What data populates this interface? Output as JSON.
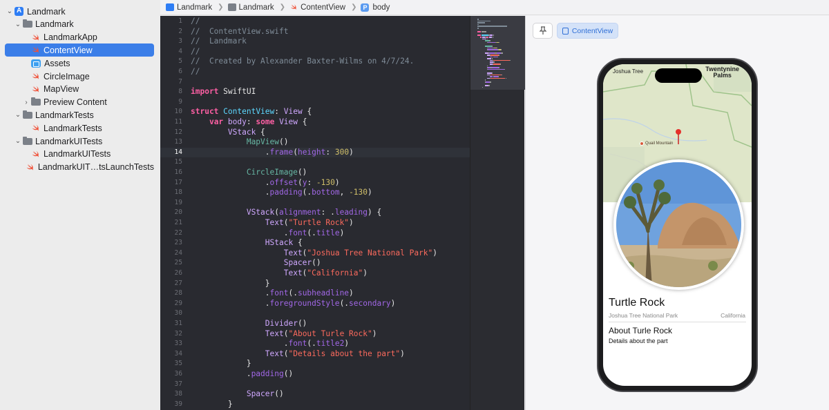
{
  "navigator": {
    "items": [
      {
        "label": "Landmark",
        "level": 0,
        "icon": "app-icon",
        "expanded": true
      },
      {
        "label": "Landmark",
        "level": 1,
        "icon": "folder-icon",
        "expanded": true
      },
      {
        "label": "LandmarkApp",
        "level": 2,
        "icon": "swift-file-icon"
      },
      {
        "label": "ContentView",
        "level": 2,
        "icon": "swift-file-icon",
        "selected": true
      },
      {
        "label": "Assets",
        "level": 2,
        "icon": "assets-icon"
      },
      {
        "label": "CircleImage",
        "level": 2,
        "icon": "swift-file-icon"
      },
      {
        "label": "MapView",
        "level": 2,
        "icon": "swift-file-icon"
      },
      {
        "label": "Preview Content",
        "level": 2,
        "icon": "folder-icon",
        "expanded": false
      },
      {
        "label": "LandmarkTests",
        "level": 1,
        "icon": "folder-icon",
        "expanded": true
      },
      {
        "label": "LandmarkTests",
        "level": 2,
        "icon": "swift-file-icon"
      },
      {
        "label": "LandmarkUITests",
        "level": 1,
        "icon": "folder-icon",
        "expanded": true
      },
      {
        "label": "LandmarkUITests",
        "level": 2,
        "icon": "swift-file-icon"
      },
      {
        "label": "LandmarkUIT…tsLaunchTests",
        "level": 2,
        "icon": "swift-file-icon"
      }
    ]
  },
  "breadcrumb": {
    "items": [
      "Landmark",
      "Landmark",
      "ContentView",
      "body"
    ]
  },
  "editor": {
    "current_line": 14,
    "lines": [
      [
        [
          "c-com",
          "//"
        ]
      ],
      [
        [
          "c-com",
          "//  ContentView.swift"
        ]
      ],
      [
        [
          "c-com",
          "//  Landmark"
        ]
      ],
      [
        [
          "c-com",
          "//"
        ]
      ],
      [
        [
          "c-com",
          "//  Created by Alexander Baxter-Wilms on 4/7/24."
        ]
      ],
      [
        [
          "c-com",
          "//"
        ]
      ],
      [],
      [
        [
          "c-kw",
          "import"
        ],
        [
          "c-plain",
          " SwiftUI"
        ]
      ],
      [],
      [
        [
          "c-kw",
          "struct"
        ],
        [
          "c-plain",
          " "
        ],
        [
          "c-ty",
          "ContentView"
        ],
        [
          "c-plain",
          ": "
        ],
        [
          "c-tp",
          "View"
        ],
        [
          "c-plain",
          " {"
        ]
      ],
      [
        [
          "c-plain",
          "    "
        ],
        [
          "c-kw",
          "var"
        ],
        [
          "c-plain",
          " "
        ],
        [
          "c-tp",
          "body"
        ],
        [
          "c-plain",
          ": "
        ],
        [
          "c-kw",
          "some"
        ],
        [
          "c-plain",
          " "
        ],
        [
          "c-tp",
          "View"
        ],
        [
          "c-plain",
          " {"
        ]
      ],
      [
        [
          "c-plain",
          "        "
        ],
        [
          "c-tp",
          "VStack"
        ],
        [
          "c-plain",
          " {"
        ]
      ],
      [
        [
          "c-plain",
          "            "
        ],
        [
          "c-idf",
          "MapView"
        ],
        [
          "c-plain",
          "()"
        ]
      ],
      [
        [
          "c-plain",
          "                ."
        ],
        [
          "c-fn",
          "frame"
        ],
        [
          "c-plain",
          "("
        ],
        [
          "c-fn",
          "height"
        ],
        [
          "c-plain",
          ": "
        ],
        [
          "c-num",
          "300"
        ],
        [
          "c-plain",
          ")"
        ]
      ],
      [],
      [
        [
          "c-plain",
          "            "
        ],
        [
          "c-idf",
          "CircleImage"
        ],
        [
          "c-plain",
          "()"
        ]
      ],
      [
        [
          "c-plain",
          "                ."
        ],
        [
          "c-fn",
          "offset"
        ],
        [
          "c-plain",
          "("
        ],
        [
          "c-fn",
          "y"
        ],
        [
          "c-plain",
          ": "
        ],
        [
          "c-num",
          "-130"
        ],
        [
          "c-plain",
          ")"
        ]
      ],
      [
        [
          "c-plain",
          "                ."
        ],
        [
          "c-fn",
          "padding"
        ],
        [
          "c-plain",
          "(."
        ],
        [
          "c-fn",
          "bottom"
        ],
        [
          "c-plain",
          ", "
        ],
        [
          "c-num",
          "-130"
        ],
        [
          "c-plain",
          ")"
        ]
      ],
      [],
      [
        [
          "c-plain",
          "            "
        ],
        [
          "c-tp",
          "VStack"
        ],
        [
          "c-plain",
          "("
        ],
        [
          "c-fn",
          "alignment"
        ],
        [
          "c-plain",
          ": ."
        ],
        [
          "c-fn",
          "leading"
        ],
        [
          "c-plain",
          ") {"
        ]
      ],
      [
        [
          "c-plain",
          "                "
        ],
        [
          "c-tp",
          "Text"
        ],
        [
          "c-plain",
          "("
        ],
        [
          "c-str",
          "\"Turtle Rock\""
        ],
        [
          "c-plain",
          ")"
        ]
      ],
      [
        [
          "c-plain",
          "                    ."
        ],
        [
          "c-fn",
          "font"
        ],
        [
          "c-plain",
          "(."
        ],
        [
          "c-fn",
          "title"
        ],
        [
          "c-plain",
          ")"
        ]
      ],
      [
        [
          "c-plain",
          "                "
        ],
        [
          "c-tp",
          "HStack"
        ],
        [
          "c-plain",
          " {"
        ]
      ],
      [
        [
          "c-plain",
          "                    "
        ],
        [
          "c-tp",
          "Text"
        ],
        [
          "c-plain",
          "("
        ],
        [
          "c-str",
          "\"Joshua Tree National Park\""
        ],
        [
          "c-plain",
          ")"
        ]
      ],
      [
        [
          "c-plain",
          "                    "
        ],
        [
          "c-tp",
          "Spacer"
        ],
        [
          "c-plain",
          "()"
        ]
      ],
      [
        [
          "c-plain",
          "                    "
        ],
        [
          "c-tp",
          "Text"
        ],
        [
          "c-plain",
          "("
        ],
        [
          "c-str",
          "\"California\""
        ],
        [
          "c-plain",
          ")"
        ]
      ],
      [
        [
          "c-plain",
          "                }"
        ]
      ],
      [
        [
          "c-plain",
          "                ."
        ],
        [
          "c-fn",
          "font"
        ],
        [
          "c-plain",
          "(."
        ],
        [
          "c-fn",
          "subheadline"
        ],
        [
          "c-plain",
          ")"
        ]
      ],
      [
        [
          "c-plain",
          "                ."
        ],
        [
          "c-fn",
          "foregroundStyle"
        ],
        [
          "c-plain",
          "(."
        ],
        [
          "c-fn",
          "secondary"
        ],
        [
          "c-plain",
          ")"
        ]
      ],
      [],
      [
        [
          "c-plain",
          "                "
        ],
        [
          "c-tp",
          "Divider"
        ],
        [
          "c-plain",
          "()"
        ]
      ],
      [
        [
          "c-plain",
          "                "
        ],
        [
          "c-tp",
          "Text"
        ],
        [
          "c-plain",
          "("
        ],
        [
          "c-str",
          "\"About Turle Rock\""
        ],
        [
          "c-plain",
          ")"
        ]
      ],
      [
        [
          "c-plain",
          "                    ."
        ],
        [
          "c-fn",
          "font"
        ],
        [
          "c-plain",
          "(."
        ],
        [
          "c-fn",
          "title2"
        ],
        [
          "c-plain",
          ")"
        ]
      ],
      [
        [
          "c-plain",
          "                "
        ],
        [
          "c-tp",
          "Text"
        ],
        [
          "c-plain",
          "("
        ],
        [
          "c-str",
          "\"Details about the part\""
        ],
        [
          "c-plain",
          ")"
        ]
      ],
      [
        [
          "c-plain",
          "            }"
        ]
      ],
      [
        [
          "c-plain",
          "            ."
        ],
        [
          "c-fn",
          "padding"
        ],
        [
          "c-plain",
          "()"
        ]
      ],
      [],
      [
        [
          "c-plain",
          "            "
        ],
        [
          "c-tp",
          "Spacer"
        ],
        [
          "c-plain",
          "()"
        ]
      ],
      [
        [
          "c-plain",
          "        }"
        ]
      ]
    ]
  },
  "canvas": {
    "pin_icon": "pin-icon",
    "preview_button_label": "ContentView"
  },
  "preview": {
    "status_left": "Joshua Tree",
    "status_right_1": "Twentynine",
    "status_right_2": "Palms",
    "place_label": "Quail Mountain",
    "title": "Turtle Rock",
    "park": "Joshua Tree National Park",
    "state": "California",
    "about": "About Turle Rock",
    "details": "Details about the part"
  }
}
